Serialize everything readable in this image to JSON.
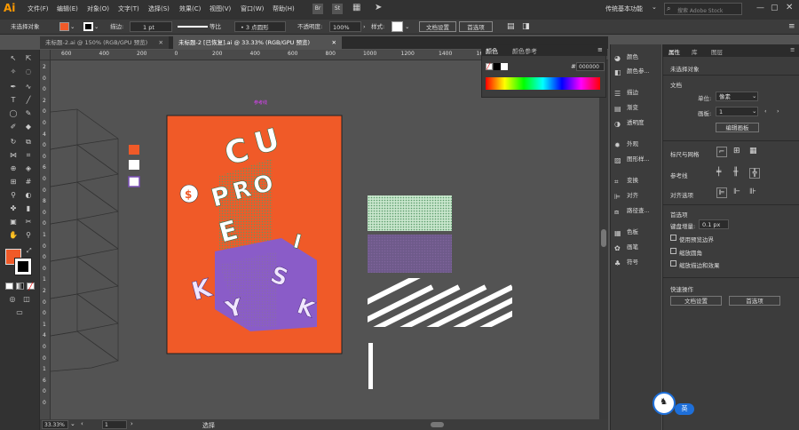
{
  "app": {
    "logo": "Ai"
  },
  "menu": [
    "文件(F)",
    "编辑(E)",
    "对象(O)",
    "文字(T)",
    "选择(S)",
    "效果(C)",
    "视图(V)",
    "窗口(W)",
    "帮助(H)"
  ],
  "menu_extra": {
    "br": "Br",
    "st": "St",
    "workspace": "传统基本功能",
    "search_placeholder": "搜索 Adobe Stock"
  },
  "control": {
    "no_selection": "未选择对象",
    "stroke_label": "描边:",
    "stroke_value": "1 pt",
    "uniform": "等比",
    "brush": "3 点圆形",
    "opacity_label": "不透明度:",
    "opacity_value": "100%",
    "style_label": "样式:",
    "doc_setup": "文档设置",
    "preferences": "首选项"
  },
  "tabs": [
    "未标题-2.ai @ 150% (RGB/GPU 预览)",
    "未标题-2 [已恢复].ai @ 33.33% (RGB/GPU 预览)"
  ],
  "ruler_h": [
    "600",
    "400",
    "200",
    "0",
    "200",
    "400",
    "600",
    "800",
    "1000",
    "1200",
    "1400",
    "1600",
    "1800",
    "2000",
    "2200",
    "2400"
  ],
  "ruler_v": [
    "2",
    "0",
    "0",
    "2",
    "0",
    "0",
    "4",
    "0",
    "0",
    "6",
    "0",
    "0",
    "8",
    "0",
    "0",
    "1",
    "0",
    "0",
    "0",
    "1",
    "2",
    "0",
    "0",
    "1",
    "4",
    "0",
    "0",
    "1",
    "6",
    "0",
    "0"
  ],
  "canvas": {
    "guide_label": "参考线",
    "artboard_color": "#f05a28",
    "letters": [
      "C",
      "U",
      "P",
      "R",
      "O",
      "E",
      "I",
      "S",
      "K",
      "Y",
      "K"
    ]
  },
  "color_panel": {
    "tab1": "颜色",
    "tab2": "颜色参考",
    "hex_label": "#",
    "hex_value": "000000"
  },
  "dock": [
    "颜色",
    "颜色参...",
    "描边",
    "渐变",
    "透明度",
    "外观",
    "图形样...",
    "变换",
    "对齐",
    "路径查...",
    "色板",
    "画笔",
    "符号"
  ],
  "dock_icons": [
    "palette-icon",
    "color-guide-icon",
    "stroke-icon",
    "gradient-icon",
    "transparency-icon",
    "appearance-icon",
    "graphic-styles-icon",
    "transform-icon",
    "align-icon",
    "pathfinder-icon",
    "swatches-icon",
    "brushes-icon",
    "symbols-icon"
  ],
  "props": {
    "tabs": [
      "属性",
      "库",
      "图层"
    ],
    "no_selection": "未选择对象",
    "doc_section": "文档",
    "unit_label": "单位:",
    "unit_value": "像素",
    "artboard_label": "画板:",
    "artboard_value": "1",
    "edit_artboard": "编辑画板",
    "rulers_section": "标尺与网格",
    "guides_section": "参考线",
    "align_section": "对齐选项",
    "prefs_section": "首选项",
    "kb_increment_label": "键盘增量:",
    "kb_increment_value": "0.1 px",
    "check1": "使用预览边界",
    "check2": "缩放圆角",
    "check3": "缩放描边和效果",
    "quick_section": "快速操作",
    "quick_doc": "文档设置",
    "quick_prefs": "首选项"
  },
  "status": {
    "zoom": "33.33%",
    "artboard": "1",
    "tool": "选择"
  },
  "badge": {
    "text": "英"
  }
}
